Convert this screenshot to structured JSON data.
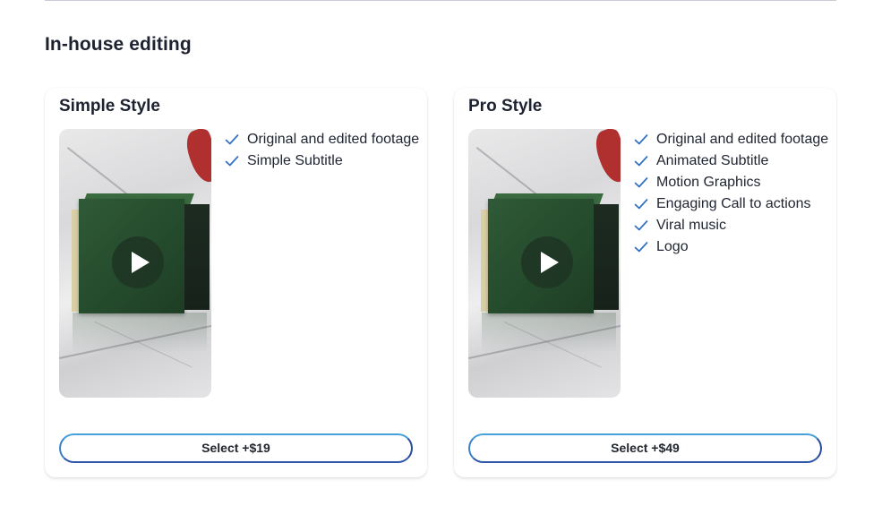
{
  "section": {
    "title": "In-house editing"
  },
  "cards": [
    {
      "title": "Simple Style",
      "features": [
        "Original and edited footage",
        "Simple Subtitle"
      ],
      "button_label": "Select +$19"
    },
    {
      "title": "Pro Style",
      "features": [
        "Original and edited footage",
        "Animated Subtitle",
        "Motion Graphics",
        "Engaging Call to actions",
        "Viral music",
        "Logo"
      ],
      "button_label": "Select +$49"
    }
  ],
  "icons": {
    "check": "check-icon",
    "play": "play-icon"
  },
  "colors": {
    "check": "#2f6fc4",
    "button_border_start": "#46a0d9",
    "button_border_end": "#2b4c9c",
    "text": "#1d2230"
  }
}
